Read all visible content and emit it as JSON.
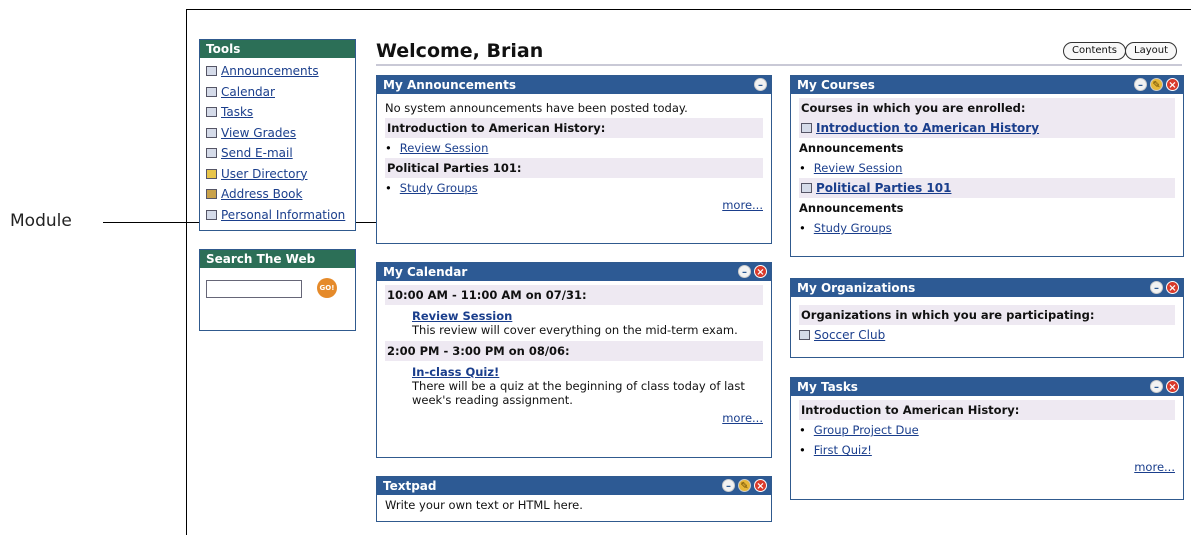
{
  "callout": {
    "label": "Module"
  },
  "page": {
    "title": "Welcome, Brian"
  },
  "top_buttons": {
    "contents": "Contents",
    "layout": "Layout"
  },
  "tools": {
    "header": "Tools",
    "items": [
      {
        "label": "Announcements",
        "icon": "book-icon"
      },
      {
        "label": "Calendar",
        "icon": "calendar-icon"
      },
      {
        "label": "Tasks",
        "icon": "tasks-icon"
      },
      {
        "label": "View Grades",
        "icon": "grades-icon"
      },
      {
        "label": "Send E-mail",
        "icon": "email-icon"
      },
      {
        "label": "User Directory",
        "icon": "user-icon"
      },
      {
        "label": "Address Book",
        "icon": "address-book-icon"
      },
      {
        "label": "Personal Information",
        "icon": "person-icon"
      }
    ]
  },
  "search": {
    "header": "Search The Web",
    "go": "GO!",
    "value": ""
  },
  "announcements": {
    "header": "My Announcements",
    "system": "No system announcements have been posted today.",
    "course1": "Introduction to American History:",
    "item1": "Review Session",
    "course2": "Political Parties 101:",
    "item2": "Study Groups",
    "more": "more..."
  },
  "calendar": {
    "header": "My Calendar",
    "event1_time": "10:00 AM - 11:00 AM on 07/31:",
    "event1_title": "Review Session",
    "event1_desc": "This review will cover everything on the mid-term exam.",
    "event2_time": "2:00 PM - 3:00 PM on 08/06:",
    "event2_title": "In-class Quiz!",
    "event2_desc": "There will be a quiz at the beginning of class today of last week's reading assignment.",
    "more": "more..."
  },
  "textpad": {
    "header": "Textpad",
    "body": "Write your own text or HTML here."
  },
  "courses": {
    "header": "My Courses",
    "intro": "Courses in which you are enrolled:",
    "course1": "Introduction to American History",
    "ann1": "Announcements",
    "item1": "Review Session",
    "course2": "Political Parties 101",
    "ann2": "Announcements",
    "item2": "Study Groups"
  },
  "organizations": {
    "header": "My Organizations",
    "intro": "Organizations in which you are participating:",
    "item1": "Soccer Club"
  },
  "tasks": {
    "header": "My Tasks",
    "course": "Introduction to American History:",
    "item1": "Group Project Due",
    "item2": "First Quiz!",
    "more": "more..."
  },
  "colors": {
    "module_header": "#2d5a94",
    "tools_header": "#2c6f57",
    "band": "#eee9f2",
    "go_button": "#e58a2a"
  }
}
